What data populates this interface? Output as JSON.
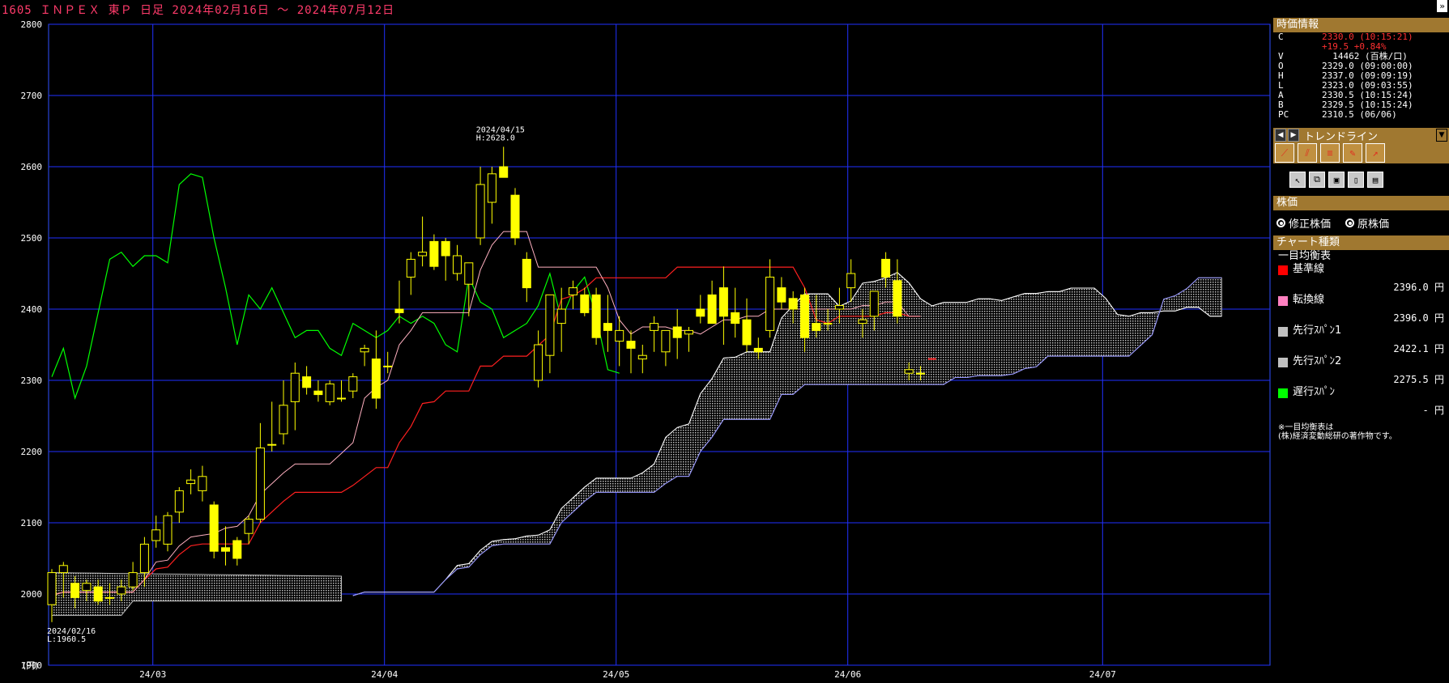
{
  "title": "1605 ＩＮＰＥＸ 東Ｐ 日足 2024年02月16日 ～ 2024年07月12日",
  "panel": {
    "quote_header": "時価情報",
    "quote": [
      {
        "k": "C",
        "v": "2330.0 (10:15:21)",
        "red": true
      },
      {
        "k": "",
        "v": "+19.5 +0.84%",
        "red": true
      },
      {
        "k": "V",
        "v": "  14462 (百株/口)",
        "red": false
      },
      {
        "k": "O",
        "v": "2329.0 (09:00:00)",
        "red": false
      },
      {
        "k": "H",
        "v": "2337.0 (09:09:19)",
        "red": false
      },
      {
        "k": "L",
        "v": "2323.0 (09:03:55)",
        "red": false
      },
      {
        "k": "A",
        "v": "2330.5 (10:15:24)",
        "red": false
      },
      {
        "k": "B",
        "v": "2329.5 (10:15:24)",
        "red": false
      },
      {
        "k": "PC",
        "v": "2310.5 (06/06)",
        "red": false
      }
    ],
    "trendline_label": "トレンドライン",
    "price_header": "株価",
    "radio_adjusted": "修正株価",
    "radio_original": "原株価",
    "chart_type_header": "チャート種類",
    "chart_type_name": "一目均衡表",
    "indicators": [
      {
        "name": "基準線",
        "value": "2396.0 円",
        "color": "#ff0000"
      },
      {
        "name": "転換線",
        "value": "2396.0 円",
        "color": "#ff80c0"
      },
      {
        "name": "先行ｽﾊﾟﾝ1",
        "value": "2422.1 円",
        "color": "#c0c0c0"
      },
      {
        "name": "先行ｽﾊﾟﾝ2",
        "value": "2275.5 円",
        "color": "#c0c0c0"
      },
      {
        "name": "遅行ｽﾊﾟﾝ",
        "value": "- 円",
        "color": "#00ff00"
      }
    ],
    "note_line1": "※一目均衡表は",
    "note_line2": "(株)経済変動総研の著作物です。"
  },
  "chart_data": {
    "type": "candlestick",
    "title": "1605 ＩＮＰＥＸ 東Ｐ 日足 2024年02月16日 ～ 2024年07月12日",
    "ylim": [
      1900,
      2800
    ],
    "y_ticks": [
      2800,
      2700,
      2600,
      2500,
      2400,
      2300,
      2200,
      2100,
      2000,
      1900
    ],
    "y_unit_label": "(円)",
    "x_labels": [
      "24/03",
      "24/04",
      "24/05",
      "24/06",
      "24/07"
    ],
    "annotations": [
      {
        "date": "2024/04/15",
        "text1": "2024/04/15",
        "text2": "H:2628.0"
      },
      {
        "date": "2024/02/16",
        "text1": "2024/02/16",
        "text2": "L:1960.5"
      }
    ],
    "dates": [
      "02/16",
      "02/19",
      "02/20",
      "02/21",
      "02/22",
      "02/26",
      "02/27",
      "02/28",
      "02/29",
      "03/01",
      "03/04",
      "03/05",
      "03/06",
      "03/07",
      "03/08",
      "03/11",
      "03/12",
      "03/13",
      "03/14",
      "03/15",
      "03/18",
      "03/19",
      "03/21",
      "03/22",
      "03/25",
      "03/26",
      "03/27",
      "03/28",
      "03/29",
      "04/01",
      "04/02",
      "04/03",
      "04/04",
      "04/05",
      "04/08",
      "04/09",
      "04/10",
      "04/11",
      "04/12",
      "04/15",
      "04/16",
      "04/17",
      "04/18",
      "04/19",
      "04/22",
      "04/23",
      "04/24",
      "04/25",
      "04/26",
      "04/30",
      "05/01",
      "05/02",
      "05/07",
      "05/08",
      "05/09",
      "05/10",
      "05/13",
      "05/14",
      "05/15",
      "05/16",
      "05/17",
      "05/20",
      "05/21",
      "05/22",
      "05/23",
      "05/24",
      "05/27",
      "05/28",
      "05/29",
      "05/30",
      "05/31",
      "06/03",
      "06/04",
      "06/05",
      "06/06",
      "06/07"
    ],
    "ohlc": [
      [
        1985,
        2035,
        1960.5,
        2030
      ],
      [
        2030,
        2045,
        1995,
        2040
      ],
      [
        2015,
        2025,
        1980,
        1995
      ],
      [
        2005,
        2020,
        1990,
        2015
      ],
      [
        2010,
        2020,
        1985,
        1990
      ],
      [
        1995,
        2015,
        1985,
        1995
      ],
      [
        2000,
        2020,
        1990,
        2010
      ],
      [
        2010,
        2045,
        2005,
        2030
      ],
      [
        2030,
        2080,
        2010,
        2070
      ],
      [
        2075,
        2110,
        2065,
        2090
      ],
      [
        2070,
        2115,
        2060,
        2110
      ],
      [
        2115,
        2150,
        2100,
        2145
      ],
      [
        2155,
        2175,
        2140,
        2160
      ],
      [
        2145,
        2180,
        2130,
        2165
      ],
      [
        2125,
        2130,
        2050,
        2060
      ],
      [
        2065,
        2095,
        2040,
        2060
      ],
      [
        2075,
        2080,
        2040,
        2050
      ],
      [
        2085,
        2110,
        2070,
        2105
      ],
      [
        2105,
        2240,
        2100,
        2205
      ],
      [
        2210,
        2270,
        2200,
        2210
      ],
      [
        2225,
        2300,
        2210,
        2265
      ],
      [
        2270,
        2325,
        2230,
        2310
      ],
      [
        2305,
        2320,
        2280,
        2290
      ],
      [
        2285,
        2300,
        2270,
        2280
      ],
      [
        2270,
        2300,
        2265,
        2295
      ],
      [
        2275,
        2300,
        2270,
        2275
      ],
      [
        2285,
        2310,
        2275,
        2305
      ],
      [
        2340,
        2350,
        2320,
        2345
      ],
      [
        2330,
        2370,
        2260,
        2275
      ],
      [
        2320,
        2340,
        2310,
        2320
      ],
      [
        2400,
        2440,
        2380,
        2395
      ],
      [
        2445,
        2480,
        2420,
        2470
      ],
      [
        2475,
        2530,
        2460,
        2480
      ],
      [
        2495,
        2505,
        2455,
        2460
      ],
      [
        2495,
        2500,
        2440,
        2475
      ],
      [
        2450,
        2490,
        2440,
        2475
      ],
      [
        2435,
        2465,
        2390,
        2465
      ],
      [
        2500,
        2600,
        2490,
        2575
      ],
      [
        2550,
        2600,
        2520,
        2590
      ],
      [
        2600,
        2628,
        2585,
        2585
      ],
      [
        2560,
        2570,
        2490,
        2500
      ],
      [
        2470,
        2480,
        2410,
        2430
      ],
      [
        2300,
        2370,
        2290,
        2350
      ],
      [
        2335,
        2400,
        2310,
        2420
      ],
      [
        2380,
        2430,
        2340,
        2400
      ],
      [
        2420,
        2440,
        2400,
        2430
      ],
      [
        2420,
        2430,
        2390,
        2395
      ],
      [
        2420,
        2430,
        2350,
        2360
      ],
      [
        2380,
        2420,
        2340,
        2370
      ],
      [
        2355,
        2390,
        2320,
        2370
      ],
      [
        2355,
        2370,
        2310,
        2345
      ],
      [
        2330,
        2350,
        2310,
        2335
      ],
      [
        2370,
        2390,
        2340,
        2380
      ],
      [
        2340,
        2370,
        2320,
        2370
      ],
      [
        2375,
        2400,
        2330,
        2360
      ],
      [
        2365,
        2375,
        2340,
        2370
      ],
      [
        2400,
        2420,
        2380,
        2390
      ],
      [
        2420,
        2440,
        2380,
        2380
      ],
      [
        2430,
        2460,
        2350,
        2390
      ],
      [
        2395,
        2430,
        2360,
        2380
      ],
      [
        2385,
        2415,
        2340,
        2350
      ],
      [
        2345,
        2360,
        2330,
        2340
      ],
      [
        2370,
        2470,
        2360,
        2445
      ],
      [
        2430,
        2445,
        2400,
        2410
      ],
      [
        2415,
        2425,
        2380,
        2400
      ],
      [
        2420,
        2430,
        2340,
        2360
      ],
      [
        2380,
        2420,
        2360,
        2370
      ],
      [
        2380,
        2400,
        2370,
        2380
      ],
      [
        2400,
        2430,
        2380,
        2405
      ],
      [
        2430,
        2470,
        2410,
        2450
      ],
      [
        2380,
        2400,
        2360,
        2385
      ],
      [
        2390,
        2400,
        2370,
        2425
      ],
      [
        2470,
        2480,
        2430,
        2445
      ],
      [
        2440,
        2470,
        2380,
        2390
      ],
      [
        2310,
        2325,
        2300,
        2315
      ],
      [
        2310,
        2320,
        2300,
        2310
      ]
    ],
    "series": [
      {
        "name": "基準線",
        "color": "#ff2020"
      },
      {
        "name": "転換線",
        "color": "#ffb0c0"
      },
      {
        "name": "先行ｽﾊﾟﾝ1",
        "color": "#c0c0c0"
      },
      {
        "name": "先行ｽﾊﾟﾝ2",
        "color": "#c0c0c0"
      },
      {
        "name": "遅行ｽﾊﾟﾝ",
        "color": "#00ff00"
      }
    ]
  }
}
